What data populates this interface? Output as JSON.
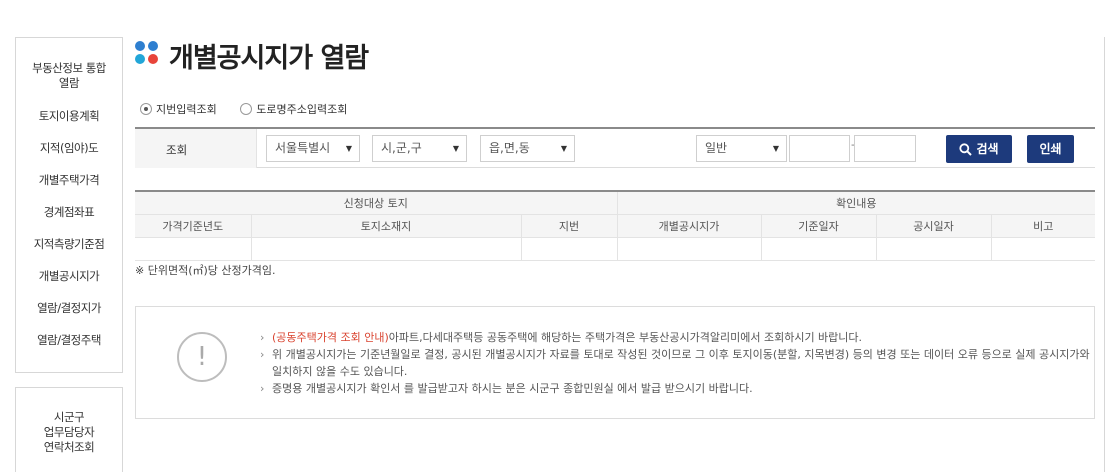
{
  "sidebar": {
    "items": [
      {
        "label": "부동산정보 통합",
        "label2": "열람"
      },
      {
        "label": "토지이용계획"
      },
      {
        "label": "지적(임야)도"
      },
      {
        "label": "개별주택가격"
      },
      {
        "label": "경계점좌표"
      },
      {
        "label": "지적측량기준점"
      },
      {
        "label": "개별공시지가"
      },
      {
        "label": "열람/결정지가"
      },
      {
        "label": "열람/결정주택"
      }
    ],
    "contact": {
      "line1": "시군구",
      "line2": "업무담당자",
      "line3": "연락처조회"
    }
  },
  "page": {
    "title": "개별공시지가 열람"
  },
  "title_dot_colors": [
    "#2e7fd0",
    "#2e7fd0",
    "#22a6d8",
    "#e8443a"
  ],
  "search_mode": {
    "options": [
      {
        "label": "지번입력조회",
        "selected": true
      },
      {
        "label": "도로명주소입력조회",
        "selected": false
      }
    ]
  },
  "search": {
    "label": "조회",
    "sido": "서울특별시",
    "sigungu": "시,군,구",
    "dong": "읍,면,동",
    "type": "일반",
    "jibun_main": "",
    "jibun_sub": "",
    "search_button": "검색",
    "print_button": "인쇄"
  },
  "table": {
    "group_headers": [
      "신청대상 토지",
      "확인내용"
    ],
    "columns": [
      "가격기준년도",
      "토지소재지",
      "지번",
      "개별공시지가",
      "기준일자",
      "공시일자",
      "비고"
    ]
  },
  "unit_note": "※ 단위면적(㎡)당 산정가격임.",
  "notice": {
    "items": [
      {
        "highlight": "(공동주택가격 조회 안내)",
        "text": "아파트,다세대주택등 공동주택에 해당하는 주택가격은 부동산공시가격알리미에서 조회하시기 바랍니다."
      },
      {
        "highlight": "",
        "text": "위 개별공시지가는 기준년월일로 결정, 공시된 개별공시지가 자료를 토대로 작성된 것이므로 그 이후 토지이동(분할, 지목변경) 등의 변경 또는 데이터 오류 등으로 실제 공시지가와",
        "text2": "일치하지 않을 수도 있습니다."
      },
      {
        "highlight": "",
        "text": "증명용 개별공시지가 확인서 를 발급받고자 하시는 분은 시군구 종합민원실 에서 발급 받으시기 바랍니다."
      }
    ]
  },
  "accent_color": "#1d3a7c"
}
